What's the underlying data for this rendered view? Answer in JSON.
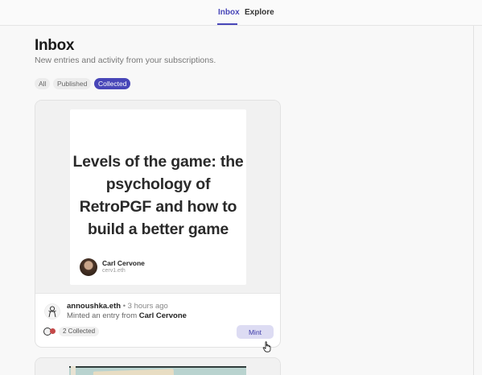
{
  "nav": {
    "tabs": [
      {
        "label": "Inbox",
        "active": true
      },
      {
        "label": "Explore",
        "active": false
      }
    ]
  },
  "header": {
    "title": "Inbox",
    "subtitle": "New entries and activity from your subscriptions."
  },
  "filters": [
    {
      "label": "All",
      "active": false
    },
    {
      "label": "Published",
      "active": false
    },
    {
      "label": "Collected",
      "active": true
    }
  ],
  "card": {
    "entry_title": "Levels of the game: the psychology of RetroPGF and how to build a better game",
    "author": {
      "name": "Carl Cervone",
      "handle": "cerv1.eth"
    },
    "activity": {
      "user": "annoushka.eth",
      "separator": "•",
      "time": "3 hours ago",
      "action_prefix": "Minted an entry from",
      "action_target": "Carl Cervone"
    },
    "collected_label": "2 Collected",
    "mint_label": "Mint"
  },
  "colors": {
    "accent": "#4846b8",
    "mint_bg": "#dddcf3"
  },
  "icons": {
    "cursor": "hand-pointer-icon"
  }
}
